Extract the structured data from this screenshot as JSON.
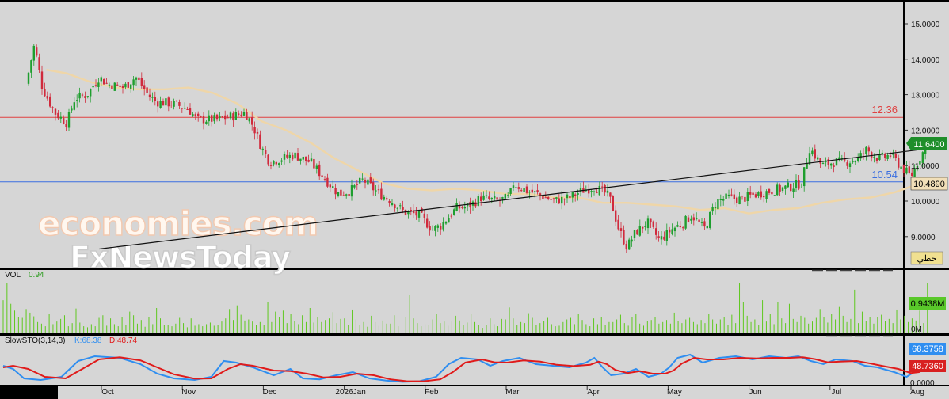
{
  "chart_data": {
    "type": "candlestick",
    "x_axis": {
      "tick_labels": [
        "Oct",
        "Nov",
        "Dec",
        "2026Jan",
        "Feb",
        "Mar",
        "Apr",
        "May",
        "Jun",
        "Jul",
        "Aug"
      ]
    },
    "price_panel": {
      "y_axis": {
        "ticks": [
          "15.0000",
          "14.0000",
          "13.0000",
          "12.0000",
          "11.0000",
          "10.0000",
          "9.0000"
        ],
        "ylim": [
          8.45,
          15.2
        ]
      },
      "last_price": 11.64,
      "last_price_label": "11.6400",
      "moving_average_label": "10.4890",
      "moving_average_value": 10.489,
      "lang_badge": "خطي",
      "horizontal_lines": [
        {
          "value": 12.36,
          "label": "12.36",
          "color": "#e04040"
        },
        {
          "value": 10.54,
          "label": "10.54",
          "color": "#3b6fe0"
        }
      ],
      "trendline": {
        "start": {
          "x_index": 0.9,
          "y": 8.65
        },
        "end": {
          "x_index": 11.3,
          "y": 11.53
        }
      },
      "series": [
        {
          "name": "price",
          "color_up": "#1e9e2e",
          "color_down": "#d02a3c",
          "close_path": [
            [
              0.0,
              13.3
            ],
            [
              0.1,
              14.4
            ],
            [
              0.2,
              13.2
            ],
            [
              0.35,
              12.5
            ],
            [
              0.5,
              12.2
            ],
            [
              0.6,
              12.9
            ],
            [
              0.75,
              13.0
            ],
            [
              0.9,
              13.5
            ],
            [
              1.0,
              13.3
            ],
            [
              1.2,
              13.2
            ],
            [
              1.35,
              13.5
            ],
            [
              1.5,
              13.0
            ],
            [
              1.6,
              12.8
            ],
            [
              1.8,
              12.75
            ],
            [
              2.0,
              12.6
            ],
            [
              2.1,
              12.3
            ],
            [
              2.35,
              12.3
            ],
            [
              2.55,
              12.4
            ],
            [
              2.7,
              12.5
            ],
            [
              2.8,
              12.1
            ],
            [
              2.9,
              11.5
            ],
            [
              3.0,
              11.1
            ],
            [
              3.15,
              11.2
            ],
            [
              3.3,
              11.3
            ],
            [
              3.5,
              11.1
            ],
            [
              3.65,
              10.7
            ],
            [
              3.85,
              10.2
            ],
            [
              4.0,
              10.3
            ],
            [
              4.15,
              10.6
            ],
            [
              4.35,
              10.2
            ],
            [
              4.5,
              10.0
            ],
            [
              4.65,
              9.7
            ],
            [
              4.85,
              9.6
            ],
            [
              5.0,
              9.2
            ],
            [
              5.1,
              9.3
            ],
            [
              5.3,
              9.8
            ],
            [
              5.45,
              9.85
            ],
            [
              5.6,
              10.1
            ],
            [
              5.8,
              10.0
            ],
            [
              5.95,
              10.1
            ],
            [
              6.0,
              10.5
            ],
            [
              6.15,
              10.3
            ],
            [
              6.3,
              10.2
            ],
            [
              6.5,
              10.0
            ],
            [
              6.7,
              10.1
            ],
            [
              6.85,
              10.3
            ],
            [
              7.0,
              10.4
            ],
            [
              7.15,
              10.2
            ],
            [
              7.2,
              10.0
            ],
            [
              7.3,
              9.2
            ],
            [
              7.4,
              8.7
            ],
            [
              7.5,
              9.1
            ],
            [
              7.65,
              9.4
            ],
            [
              7.8,
              8.9
            ],
            [
              7.95,
              9.2
            ],
            [
              8.1,
              9.4
            ],
            [
              8.2,
              9.6
            ],
            [
              8.35,
              9.2
            ],
            [
              8.5,
              10.0
            ],
            [
              8.65,
              10.1
            ],
            [
              8.8,
              10.05
            ],
            [
              9.0,
              10.2
            ],
            [
              9.2,
              10.3
            ],
            [
              9.4,
              10.4
            ],
            [
              9.55,
              10.5
            ],
            [
              9.65,
              11.5
            ],
            [
              9.8,
              11.0
            ],
            [
              9.95,
              11.1
            ],
            [
              10.1,
              11.1
            ],
            [
              10.25,
              11.2
            ],
            [
              10.35,
              11.45
            ],
            [
              10.5,
              11.2
            ],
            [
              10.65,
              11.3
            ],
            [
              10.8,
              10.9
            ],
            [
              10.9,
              10.7
            ],
            [
              11.0,
              11.2
            ],
            [
              11.1,
              11.6
            ]
          ],
          "ma_path": [
            [
              0.25,
              13.7
            ],
            [
              0.5,
              13.6
            ],
            [
              0.8,
              13.35
            ],
            [
              1.1,
              13.2
            ],
            [
              1.4,
              13.15
            ],
            [
              1.7,
              13.15
            ],
            [
              2.0,
              13.2
            ],
            [
              2.3,
              13.05
            ],
            [
              2.6,
              12.75
            ],
            [
              2.9,
              12.25
            ],
            [
              3.2,
              12.0
            ],
            [
              3.5,
              11.65
            ],
            [
              3.8,
              11.2
            ],
            [
              4.1,
              10.85
            ],
            [
              4.4,
              10.5
            ],
            [
              4.7,
              10.35
            ],
            [
              5.0,
              10.3
            ],
            [
              5.3,
              10.35
            ],
            [
              5.6,
              10.3
            ],
            [
              5.9,
              10.2
            ],
            [
              6.2,
              10.2
            ],
            [
              6.5,
              10.1
            ],
            [
              6.8,
              10.1
            ],
            [
              7.1,
              9.95
            ],
            [
              7.4,
              9.95
            ],
            [
              7.7,
              9.9
            ],
            [
              8.0,
              9.85
            ],
            [
              8.3,
              9.75
            ],
            [
              8.6,
              9.8
            ],
            [
              8.9,
              9.65
            ],
            [
              9.2,
              9.75
            ],
            [
              9.5,
              9.8
            ],
            [
              9.8,
              9.95
            ],
            [
              10.1,
              10.05
            ],
            [
              10.4,
              10.1
            ],
            [
              10.7,
              10.25
            ],
            [
              11.0,
              10.49
            ]
          ]
        }
      ]
    },
    "volume_panel": {
      "indicator_label": "VOL",
      "indicator_value": "0.94",
      "y_axis": {
        "ticks": [
          "0M"
        ]
      },
      "last_volume_label": "0.9438M",
      "last_volume": 0.9438,
      "bar_color": "#5ec81e",
      "volumes": [
        0.62,
        0.95,
        0.55,
        0.42,
        0.3,
        0.28,
        0.45,
        0.38,
        0.31,
        0.2,
        0.17,
        0.12,
        0.35,
        0.16,
        0.21,
        0.26,
        0.33,
        0.12,
        0.18,
        0.46,
        0.19,
        0.12,
        0.1,
        0.16,
        0.12,
        0.28,
        0.33,
        0.13,
        0.27,
        0.16,
        0.12,
        0.3,
        0.15,
        0.4,
        0.33,
        0.17,
        0.24,
        0.11,
        0.3,
        0.16,
        0.47,
        0.27,
        0.14,
        0.15,
        0.12,
        0.17,
        0.28,
        0.18,
        0.1,
        0.27,
        0.13,
        0.16,
        0.12,
        0.16,
        0.19,
        0.13,
        0.14,
        0.21,
        0.27,
        0.45,
        0.24,
        0.52,
        0.34,
        0.23,
        0.25,
        0.21,
        0.14,
        0.2,
        0.15,
        0.58,
        0.2,
        0.4,
        0.3,
        0.42,
        0.18,
        0.35,
        0.22,
        0.16,
        0.33,
        0.2,
        0.47,
        0.19,
        0.29,
        0.2,
        0.24,
        0.27,
        0.39,
        0.18,
        0.26,
        0.27,
        0.15,
        0.44,
        0.25,
        0.14,
        0.2,
        0.11,
        0.32,
        0.2,
        0.13,
        0.23,
        0.17,
        0.17,
        0.33,
        0.12,
        0.18,
        0.3,
        0.72,
        0.27,
        0.18,
        0.12,
        0.16,
        0.14,
        0.25,
        0.35,
        0.18,
        0.21,
        0.13,
        0.21,
        0.32,
        0.23,
        0.15,
        0.19,
        0.35,
        0.2,
        0.14,
        0.09,
        0.15,
        0.27,
        0.16,
        0.12,
        0.26,
        0.25,
        0.48,
        0.27,
        0.15,
        0.2,
        0.18,
        0.37,
        0.28,
        0.14,
        0.18,
        0.22,
        0.28,
        0.16,
        0.12,
        0.13,
        0.2,
        0.25,
        0.28,
        0.16,
        0.35,
        0.24,
        0.16,
        0.12,
        0.27,
        0.16,
        0.3,
        0.14,
        0.2,
        0.2,
        0.25,
        0.34,
        0.18,
        0.13,
        0.29,
        0.36,
        0.17,
        0.13,
        0.22,
        0.24,
        0.3,
        0.17,
        0.2,
        0.24,
        0.17,
        0.38,
        0.22,
        0.18,
        0.25,
        0.28,
        0.2,
        0.16,
        0.24,
        0.18,
        0.36,
        0.25,
        0.17,
        0.25,
        0.3,
        0.15,
        0.34,
        0.18,
        0.95,
        0.58,
        0.32,
        0.2,
        0.25,
        0.15,
        0.62,
        0.21,
        0.35,
        0.16,
        0.58,
        0.27,
        0.18,
        0.55,
        0.26,
        0.2,
        0.32,
        0.28,
        0.17,
        0.21,
        0.28,
        0.45,
        0.3,
        0.19,
        0.36,
        0.25,
        0.49,
        0.32,
        0.2,
        0.26,
        0.82,
        0.18,
        0.4,
        0.22,
        0.3,
        0.17,
        0.29,
        0.34,
        0.22,
        0.26,
        0.18,
        0.44,
        0.25,
        0.32,
        0.2,
        0.27,
        0.23,
        0.42,
        0.18,
        0.94
      ]
    },
    "stochastic_panel": {
      "indicator_label": "SlowSTO(3,14,3)",
      "k_label": "K:68.38",
      "d_label": "D:48.74",
      "y_axis": {
        "ticks": [
          "0.0000"
        ]
      },
      "k_value_label": "68.3758",
      "d_value_label": "48.7360",
      "k_value": 68.3758,
      "d_value": 48.736,
      "k_color": "#2f8ef0",
      "d_color": "#e01b1b",
      "k_path": [
        [
          0,
          55
        ],
        [
          0.12,
          45
        ],
        [
          0.25,
          15
        ],
        [
          0.45,
          10
        ],
        [
          0.7,
          20
        ],
        [
          0.9,
          70
        ],
        [
          1.1,
          85
        ],
        [
          1.4,
          80
        ],
        [
          1.65,
          60
        ],
        [
          1.85,
          30
        ],
        [
          2.05,
          15
        ],
        [
          2.3,
          10
        ],
        [
          2.5,
          20
        ],
        [
          2.65,
          70
        ],
        [
          2.8,
          65
        ],
        [
          3.0,
          50
        ],
        [
          3.25,
          25
        ],
        [
          3.45,
          45
        ],
        [
          3.6,
          15
        ],
        [
          3.8,
          12
        ],
        [
          4.0,
          25
        ],
        [
          4.2,
          35
        ],
        [
          4.4,
          15
        ],
        [
          4.6,
          8
        ],
        [
          4.8,
          4
        ],
        [
          5.0,
          6
        ],
        [
          5.2,
          20
        ],
        [
          5.35,
          60
        ],
        [
          5.5,
          80
        ],
        [
          5.7,
          75
        ],
        [
          5.85,
          55
        ],
        [
          6.0,
          70
        ],
        [
          6.2,
          80
        ],
        [
          6.4,
          60
        ],
        [
          6.6,
          55
        ],
        [
          6.8,
          50
        ],
        [
          7.0,
          65
        ],
        [
          7.1,
          80
        ],
        [
          7.2,
          50
        ],
        [
          7.3,
          25
        ],
        [
          7.45,
          30
        ],
        [
          7.6,
          45
        ],
        [
          7.75,
          20
        ],
        [
          7.9,
          30
        ],
        [
          8.0,
          50
        ],
        [
          8.1,
          80
        ],
        [
          8.25,
          90
        ],
        [
          8.4,
          65
        ],
        [
          8.6,
          80
        ],
        [
          8.8,
          85
        ],
        [
          9.0,
          75
        ],
        [
          9.2,
          85
        ],
        [
          9.4,
          80
        ],
        [
          9.55,
          85
        ],
        [
          9.7,
          70
        ],
        [
          9.85,
          60
        ],
        [
          10.0,
          75
        ],
        [
          10.2,
          70
        ],
        [
          10.35,
          55
        ],
        [
          10.5,
          50
        ],
        [
          10.7,
          35
        ],
        [
          10.85,
          20
        ],
        [
          11.0,
          45
        ],
        [
          11.1,
          68
        ]
      ],
      "d_path": [
        [
          0,
          50
        ],
        [
          0.12,
          55
        ],
        [
          0.3,
          45
        ],
        [
          0.5,
          20
        ],
        [
          0.75,
          15
        ],
        [
          0.95,
          45
        ],
        [
          1.15,
          75
        ],
        [
          1.4,
          82
        ],
        [
          1.65,
          72
        ],
        [
          1.85,
          50
        ],
        [
          2.05,
          28
        ],
        [
          2.3,
          14
        ],
        [
          2.5,
          15
        ],
        [
          2.7,
          45
        ],
        [
          2.85,
          60
        ],
        [
          3.0,
          55
        ],
        [
          3.25,
          40
        ],
        [
          3.45,
          38
        ],
        [
          3.65,
          30
        ],
        [
          3.85,
          18
        ],
        [
          4.05,
          20
        ],
        [
          4.25,
          30
        ],
        [
          4.45,
          25
        ],
        [
          4.65,
          12
        ],
        [
          4.85,
          6
        ],
        [
          5.05,
          6
        ],
        [
          5.25,
          12
        ],
        [
          5.4,
          35
        ],
        [
          5.55,
          65
        ],
        [
          5.75,
          75
        ],
        [
          5.9,
          66
        ],
        [
          6.05,
          65
        ],
        [
          6.25,
          72
        ],
        [
          6.45,
          68
        ],
        [
          6.65,
          58
        ],
        [
          6.85,
          54
        ],
        [
          7.05,
          58
        ],
        [
          7.15,
          68
        ],
        [
          7.25,
          60
        ],
        [
          7.35,
          42
        ],
        [
          7.5,
          32
        ],
        [
          7.65,
          38
        ],
        [
          7.8,
          30
        ],
        [
          7.95,
          30
        ],
        [
          8.05,
          40
        ],
        [
          8.15,
          62
        ],
        [
          8.3,
          80
        ],
        [
          8.45,
          75
        ],
        [
          8.65,
          75
        ],
        [
          8.85,
          80
        ],
        [
          9.05,
          78
        ],
        [
          9.25,
          80
        ],
        [
          9.45,
          80
        ],
        [
          9.6,
          82
        ],
        [
          9.75,
          76
        ],
        [
          9.9,
          66
        ],
        [
          10.05,
          68
        ],
        [
          10.25,
          70
        ],
        [
          10.4,
          63
        ],
        [
          10.55,
          55
        ],
        [
          10.75,
          45
        ],
        [
          10.9,
          32
        ],
        [
          11.0,
          35
        ],
        [
          11.1,
          48.7
        ]
      ]
    }
  },
  "watermark": {
    "brand_line1": "economies.com",
    "brand_line2": "FxNewsToday"
  }
}
